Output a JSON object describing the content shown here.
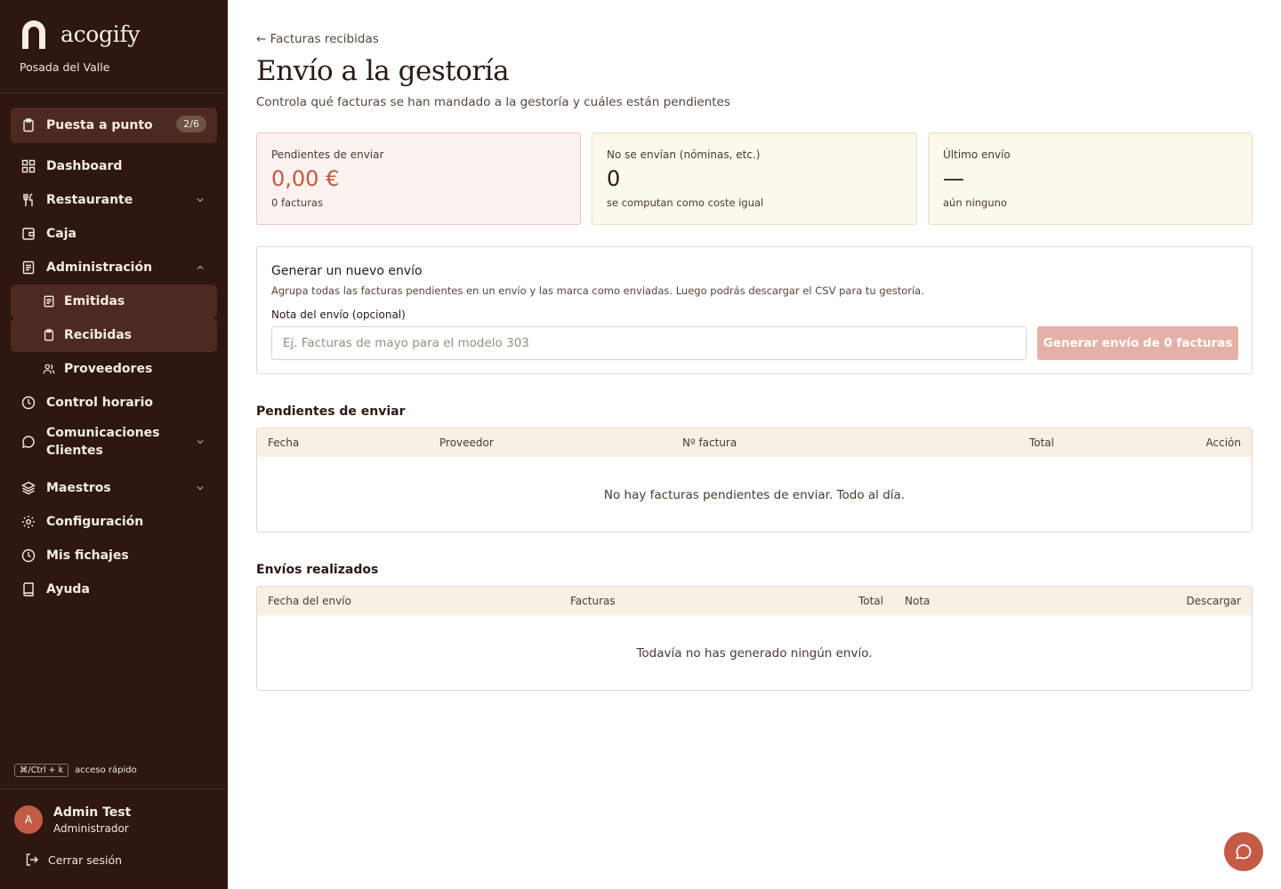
{
  "sidebar": {
    "brand_name": "acogify",
    "property_name": "Posada del Valle",
    "setup": {
      "label": "Puesta a punto",
      "badge": "2/6"
    },
    "items": [
      {
        "label": "Dashboard",
        "icon": "grid-icon"
      },
      {
        "label": "Restaurante",
        "icon": "utensils-icon"
      },
      {
        "label": "Caja",
        "icon": "wallet-icon"
      },
      {
        "label": "Administración",
        "icon": "document-icon"
      },
      {
        "label": "Emitidas",
        "icon": "document-icon"
      },
      {
        "label": "Recibidas",
        "icon": "clipboard-icon"
      },
      {
        "label": "Proveedores",
        "icon": "users-icon"
      },
      {
        "label": "Control horario",
        "icon": "clock-icon"
      },
      {
        "label": "Comunicaciones Clientes",
        "icon": "chat-icon"
      },
      {
        "label": "Maestros",
        "icon": "layers-icon"
      },
      {
        "label": "Configuración",
        "icon": "gear-icon"
      },
      {
        "label": "Mis fichajes",
        "icon": "clock-icon"
      },
      {
        "label": "Ayuda",
        "icon": "book-icon"
      }
    ],
    "shortcut_key": "⌘/Ctrl + k",
    "shortcut_label": "acceso rápido",
    "user": {
      "initial": "A",
      "name": "Admin Test",
      "role": "Administrador"
    },
    "logout_label": "Cerrar sesión"
  },
  "header": {
    "back_label": "← Facturas recibidas",
    "title": "Envío a la gestoría",
    "subtitle": "Controla qué facturas se han mandado a la gestoría y cuáles están pendientes"
  },
  "stats": [
    {
      "label": "Pendientes de enviar",
      "value": "0,00 €",
      "note": "0 facturas"
    },
    {
      "label": "No se envían (nóminas, etc.)",
      "value": "0",
      "note": "se computan como coste igual"
    },
    {
      "label": "Último envío",
      "value": "—",
      "note": "aún ninguno"
    }
  ],
  "new_shipment": {
    "title": "Generar un nuevo envío",
    "description": "Agrupa todas las facturas pendientes en un envío y las marca como enviadas. Luego podrás descargar el CSV para tu gestoría.",
    "note_label": "Nota del envío (opcional)",
    "note_placeholder": "Ej. Facturas de mayo para el modelo 303",
    "note_value": "",
    "button_label": "Generar envío de 0 facturas"
  },
  "pending": {
    "title": "Pendientes de enviar",
    "columns": [
      "Fecha",
      "Proveedor",
      "Nº factura",
      "Total",
      "Acción"
    ],
    "empty_message": "No hay facturas pendientes de enviar. Todo al día."
  },
  "done": {
    "title": "Envíos realizados",
    "columns": [
      "Fecha del envío",
      "Facturas",
      "Total",
      "Nota",
      "Descargar"
    ],
    "empty_message": "Todavía no has generado ningún envío."
  },
  "colors": {
    "sidebar_bg": "#2d1710",
    "accent": "#c35b46",
    "button_disabled": "#e4b1a6",
    "table_header_bg": "#f7f1e3"
  }
}
